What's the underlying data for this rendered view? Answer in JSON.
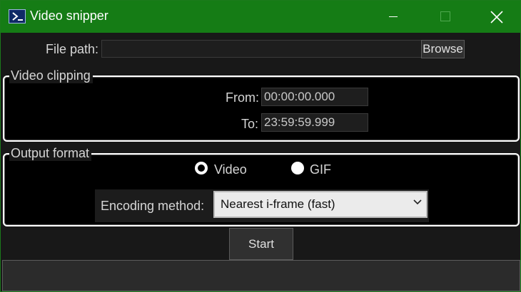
{
  "window": {
    "title": "Video snipper",
    "icon": "powershell-icon",
    "controls": [
      "minimize-icon",
      "maximize-icon",
      "close-icon"
    ]
  },
  "file": {
    "label": "File path:",
    "value": "",
    "browse_label": "Browse"
  },
  "clipping": {
    "legend": "Video clipping",
    "from_label": "From:",
    "from_value": "00:00:00.000",
    "to_label": "To:",
    "to_value": "23:59:59.999"
  },
  "output": {
    "legend": "Output format",
    "options": [
      {
        "label": "Video",
        "selected": true
      },
      {
        "label": "GIF",
        "selected": false
      }
    ],
    "encoding_label": "Encoding method:",
    "encoding_value": "Nearest i-frame (fast)"
  },
  "actions": {
    "start_label": "Start"
  },
  "status": {
    "text": ""
  },
  "colors": {
    "titlebar": "#157c15",
    "background": "#181818",
    "group_background": "#000000",
    "group_border": "#ffffff"
  }
}
